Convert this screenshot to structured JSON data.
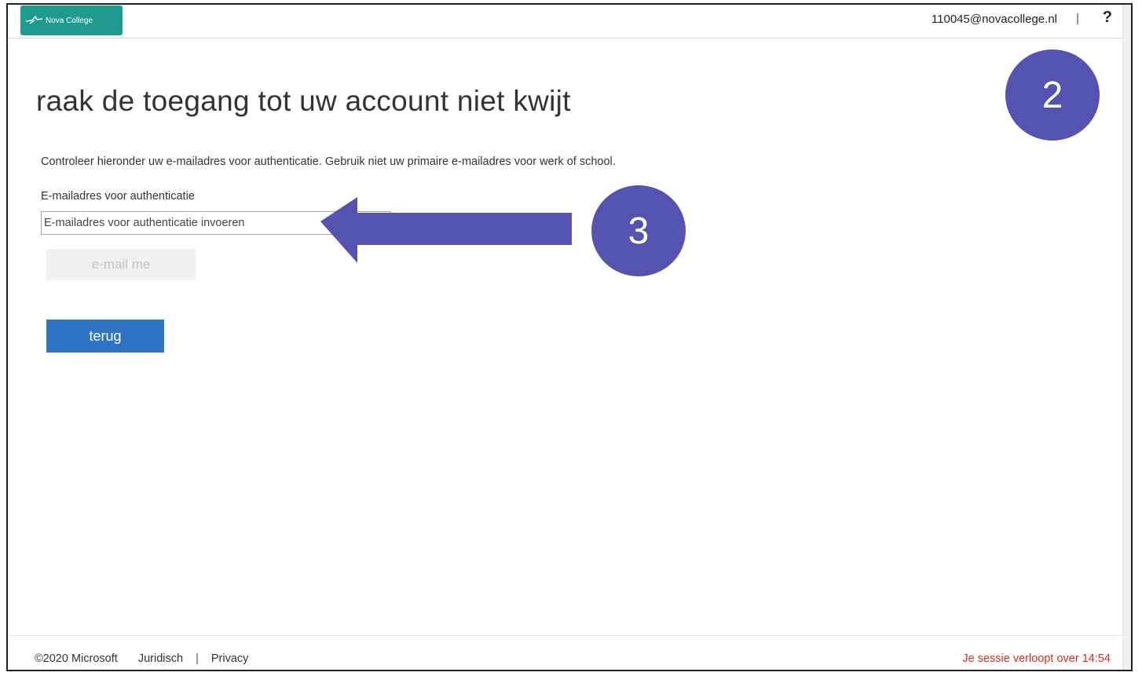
{
  "header": {
    "logo_text": "Nova College",
    "user_email": "110045@novacollege.nl",
    "separator": "|",
    "help_icon": "?"
  },
  "main": {
    "title": "raak de toegang tot uw account niet kwijt",
    "description": "Controleer hieronder uw e-mailadres voor authenticatie. Gebruik niet uw primaire e-mailadres voor werk of school.",
    "email_label": "E-mailadres voor authenticatie",
    "email_value": "",
    "email_placeholder": "E-mailadres voor authenticatie invoeren",
    "email_me_label": "e-mail me",
    "back_label": "terug"
  },
  "annotations": {
    "step_2": "2",
    "step_3": "3",
    "color": "#5454b0"
  },
  "footer": {
    "copyright": "©2020 Microsoft",
    "legal_label": "Juridisch",
    "separator": "|",
    "privacy_label": "Privacy",
    "session_text": "Je sessie verloopt over 14:54"
  },
  "colors": {
    "brand": "#1f9a8f",
    "primary_button": "#2f74c4",
    "disabled_button": "#f0f0f0",
    "session_warning": "#d62d20"
  },
  "icons": {
    "logo": "nova-college-logo",
    "help": "help-icon"
  }
}
